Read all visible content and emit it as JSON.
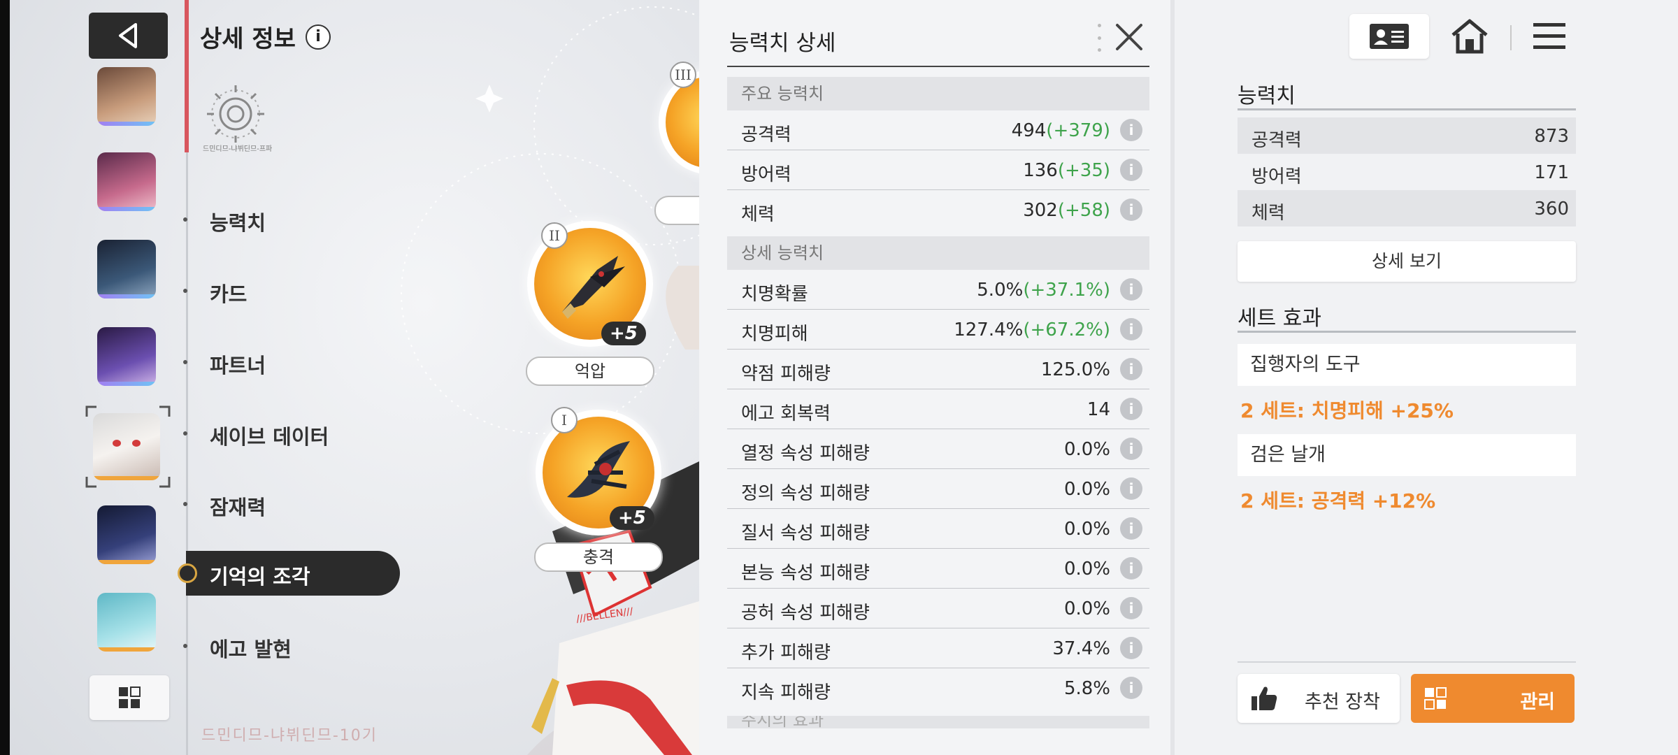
{
  "header": {
    "page_title": "상세 정보",
    "info_glyph": "i"
  },
  "emblem_caption": "드민디므-냐뷔딘므-프파",
  "nav": {
    "items": [
      {
        "label": "능력치"
      },
      {
        "label": "카드"
      },
      {
        "label": "파트너"
      },
      {
        "label": "세이브 데이터"
      },
      {
        "label": "잠재력"
      },
      {
        "label": "기억의 조각",
        "active": true
      },
      {
        "label": "에고 발현"
      }
    ]
  },
  "bottom_logo": "드민디므-냐뷔딘므-10기",
  "memory_slots": [
    {
      "roman": "III"
    },
    {
      "roman": "II",
      "level": "+5",
      "label": "억압"
    },
    {
      "roman": "I",
      "level": "+5",
      "label": "충격"
    }
  ],
  "banner_text": "///BELLEN///",
  "stat_detail": {
    "title": "능력치 상세",
    "main_section": "주요 능력치",
    "main": [
      {
        "label": "공격력",
        "value": "494",
        "bonus": "(+379)"
      },
      {
        "label": "방어력",
        "value": "136",
        "bonus": "(+35)"
      },
      {
        "label": "체력",
        "value": "302",
        "bonus": "(+58)"
      }
    ],
    "detail_section": "상세 능력치",
    "detail": [
      {
        "label": "치명확률",
        "value": "5.0%",
        "bonus": "(+37.1%)"
      },
      {
        "label": "치명피해",
        "value": "127.4%",
        "bonus": "(+67.2%)"
      },
      {
        "label": "약점 피해량",
        "value": "125.0%",
        "bonus": ""
      },
      {
        "label": "에고 회복력",
        "value": "14",
        "bonus": ""
      },
      {
        "label": "열정 속성 피해량",
        "value": "0.0%",
        "bonus": ""
      },
      {
        "label": "정의 속성 피해량",
        "value": "0.0%",
        "bonus": ""
      },
      {
        "label": "질서 속성 피해량",
        "value": "0.0%",
        "bonus": ""
      },
      {
        "label": "본능 속성 피해량",
        "value": "0.0%",
        "bonus": ""
      },
      {
        "label": "공허 속성 피해량",
        "value": "0.0%",
        "bonus": ""
      },
      {
        "label": "추가 피해량",
        "value": "37.4%",
        "bonus": ""
      },
      {
        "label": "지속 피해량",
        "value": "5.8%",
        "bonus": ""
      }
    ],
    "cut_section": "주시의 효과"
  },
  "summary": {
    "stats_heading": "능력치",
    "stats": [
      {
        "label": "공격력",
        "value": "873"
      },
      {
        "label": "방어력",
        "value": "171"
      },
      {
        "label": "체력",
        "value": "360"
      }
    ],
    "detail_button": "상세 보기",
    "set_heading": "세트 효과",
    "sets": [
      {
        "name": "집행자의 도구",
        "effect": "2 세트: 치명피해 +25%"
      },
      {
        "name": "검은 날개",
        "effect": "2 세트: 공격력 +12%"
      }
    ],
    "recommend_button": "추천 장착",
    "manage_button": "관리"
  },
  "colors": {
    "accent_orange": "#ef8a2f",
    "bonus_green": "#3ea34b",
    "dark": "#2b2b2b"
  },
  "icons": {
    "back": "triangle-left",
    "profile": "id-card",
    "home": "house",
    "menu": "hamburger",
    "grid": "grid-four"
  }
}
